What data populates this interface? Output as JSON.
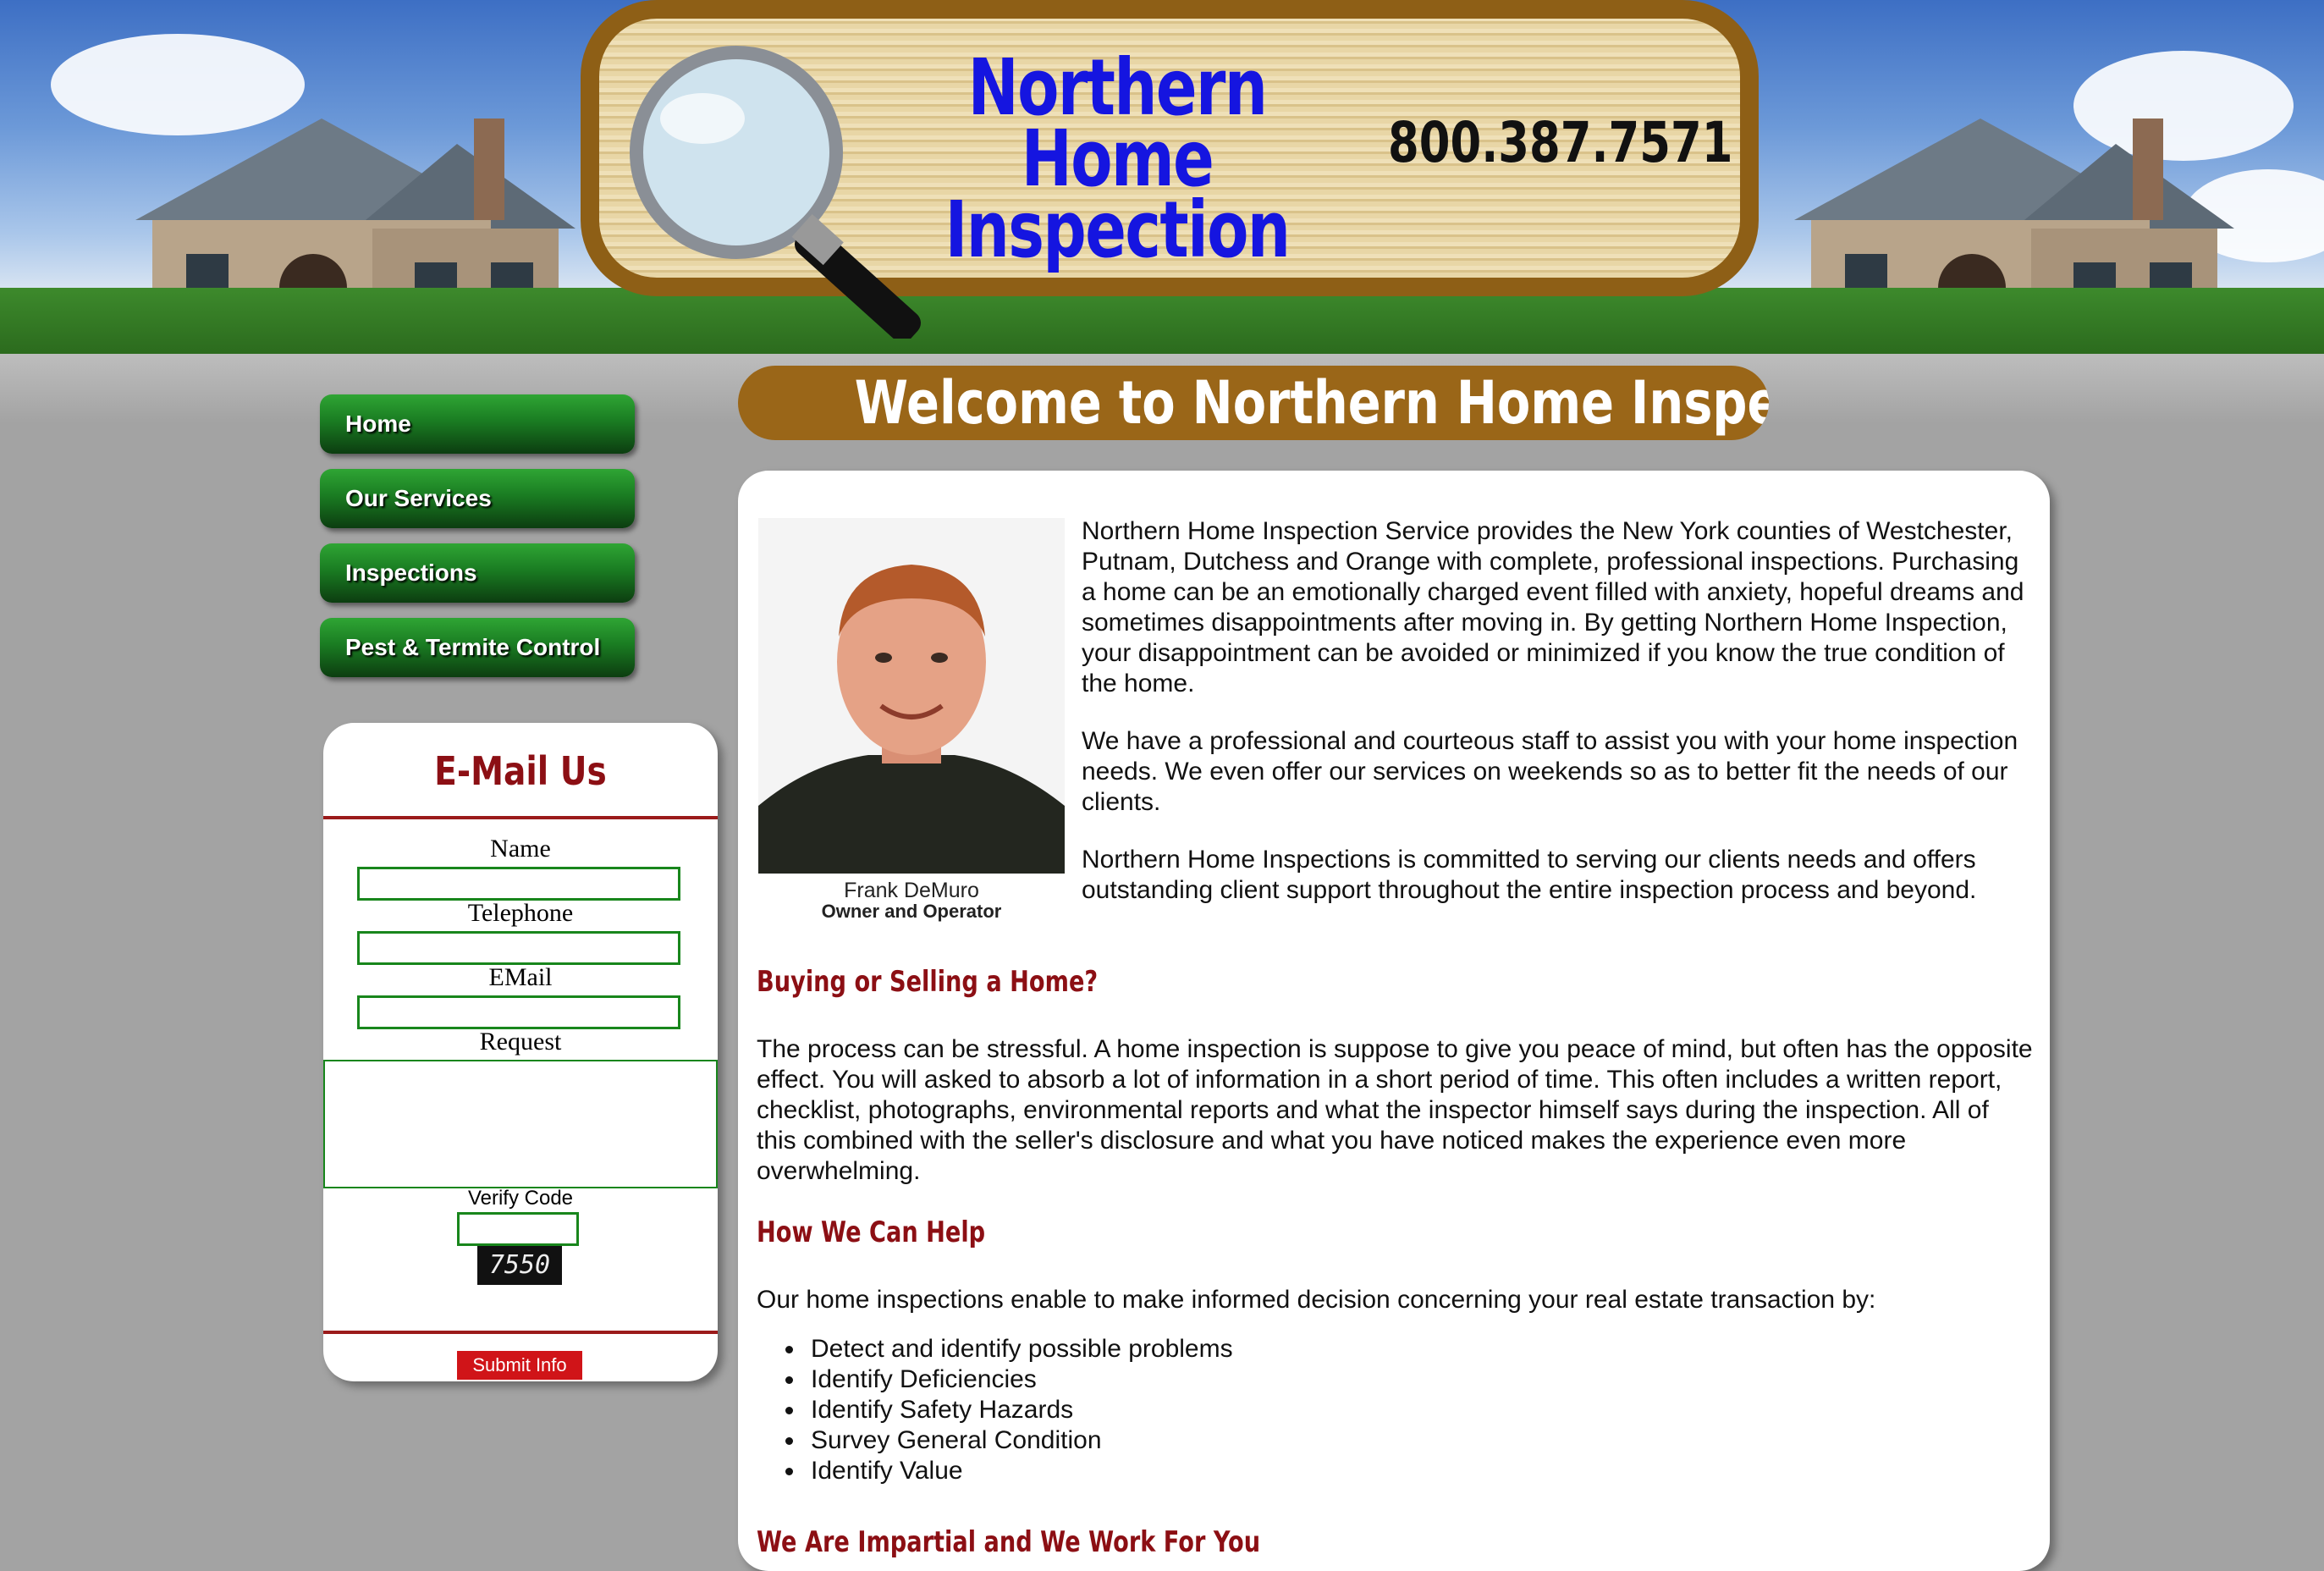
{
  "brand": {
    "title_line1": "Northern Home",
    "title_line2": "Inspection",
    "phone": "800.387.7571"
  },
  "welcome": "Welcome to Northern Home Inspection",
  "nav": {
    "items": [
      {
        "label": "Home"
      },
      {
        "label": "Our Services"
      },
      {
        "label": "Inspections"
      },
      {
        "label": "Pest & Termite Control"
      }
    ]
  },
  "email_form": {
    "title": "E-Mail Us",
    "name_label": "Name",
    "telephone_label": "Telephone",
    "email_label": "EMail",
    "request_label": "Request",
    "verify_label": "Verify Code",
    "captcha_code": "7550",
    "submit_label": "Submit Info"
  },
  "content": {
    "photo_name": "Frank DeMuro",
    "photo_role": "Owner and Operator",
    "intro_p1": "Northern Home Inspection Service provides the New York counties of Westchester, Putnam, Dutchess and Orange with complete, professional inspections. Purchasing a home can be an emotionally charged event filled with anxiety, hopeful dreams and sometimes disappointments after moving in. By getting Northern Home Inspection, your disappointment can be avoided or minimized if you know the true condition of the home.",
    "intro_p2": "We have a professional and courteous staff to assist you with your home inspection needs. We even offer our services on weekends so as to better fit the needs of our clients.",
    "intro_p3": "Northern Home Inspections is committed to serving our clients needs and offers outstanding client support throughout the entire inspection process and beyond.",
    "heading_buying": "Buying or Selling a Home?",
    "buying_text": "The process can be stressful. A home inspection is suppose to give you peace of mind, but often has the opposite effect. You will asked to absorb a lot of information in a short period of time. This often includes a written report, checklist, photographs, environmental reports and what the inspector himself says during the inspection. All of this combined with the seller's disclosure and what you have noticed makes the experience even more overwhelming.",
    "heading_help": "How We Can Help",
    "help_text": "Our home inspections enable to make informed decision concerning your real estate transaction by:",
    "bullets": [
      "Detect and identify possible problems",
      "Identify Deficiencies",
      "Identify Safety Hazards",
      "Survey General Condition",
      "Identify Value"
    ],
    "heading_impartial": "We Are Impartial and We Work For You"
  },
  "colors": {
    "nav_green": "#1a7c22",
    "heading_red": "#8c0f14",
    "banner_brown": "#9a6618",
    "submit_red": "#d01418"
  }
}
